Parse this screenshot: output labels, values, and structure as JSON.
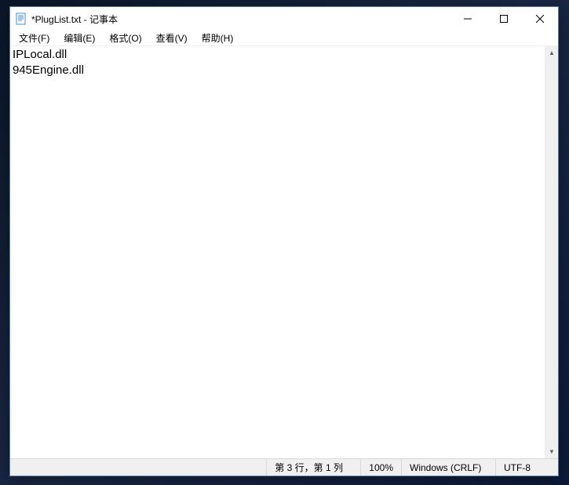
{
  "titlebar": {
    "title": "*PlugList.txt - 记事本",
    "icons": {
      "app": "notepad-icon",
      "minimize": "minimize-icon",
      "maximize": "maximize-icon",
      "close": "close-icon"
    }
  },
  "menu": {
    "file": "文件(F)",
    "edit": "编辑(E)",
    "format": "格式(O)",
    "view": "查看(V)",
    "help": "帮助(H)"
  },
  "editor": {
    "content": "IPLocal.dll\n945Engine.dll\n"
  },
  "statusbar": {
    "position": "第 3 行，第 1 列",
    "zoom": "100%",
    "eol": "Windows (CRLF)",
    "encoding": "UTF-8"
  }
}
